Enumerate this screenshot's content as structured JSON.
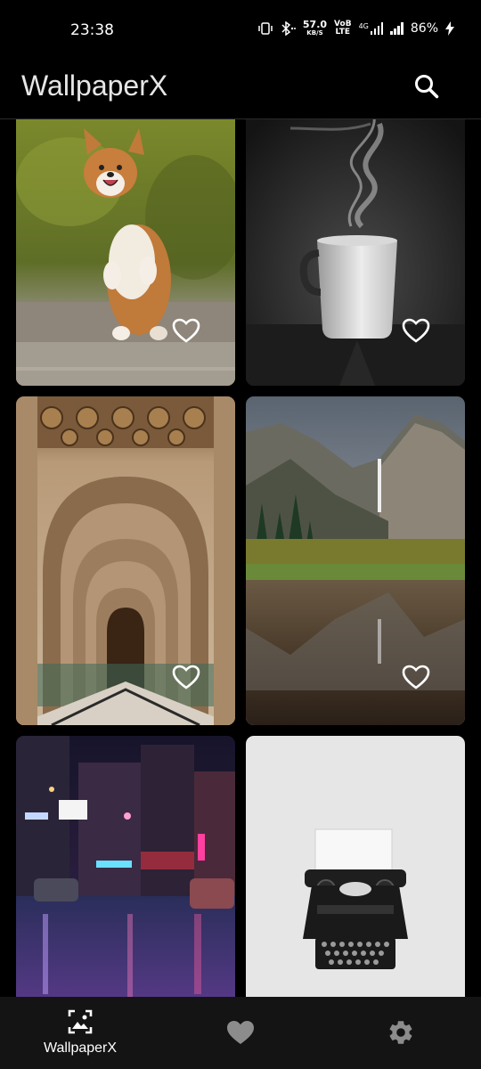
{
  "status": {
    "time": "23:38",
    "net_speed": "57.0",
    "net_unit": "KB/S",
    "volte": "VoB",
    "lte": "LTE",
    "net_type": "4G",
    "battery": "86%"
  },
  "app_bar": {
    "title": "WallpaperX",
    "search_icon": "search-icon"
  },
  "wallpapers": [
    {
      "subject": "corgi",
      "favorite_icon": "heart-outline-icon"
    },
    {
      "subject": "coffee-cup",
      "favorite_icon": "heart-outline-icon"
    },
    {
      "subject": "mosque-arches",
      "favorite_icon": "heart-outline-icon"
    },
    {
      "subject": "yosemite-falls",
      "favorite_icon": "heart-outline-icon"
    },
    {
      "subject": "neon-city-street"
    },
    {
      "subject": "typewriter"
    }
  ],
  "bottom_nav": {
    "items": [
      {
        "label": "WallpaperX",
        "icon": "wallpaper-icon",
        "active": true
      },
      {
        "label": "",
        "icon": "heart-icon",
        "active": false
      },
      {
        "label": "",
        "icon": "gear-icon",
        "active": false
      }
    ]
  },
  "colors": {
    "background": "#000000",
    "nav_background": "#141414",
    "icon_inactive": "#8c8c8c",
    "text": "#ffffff"
  }
}
